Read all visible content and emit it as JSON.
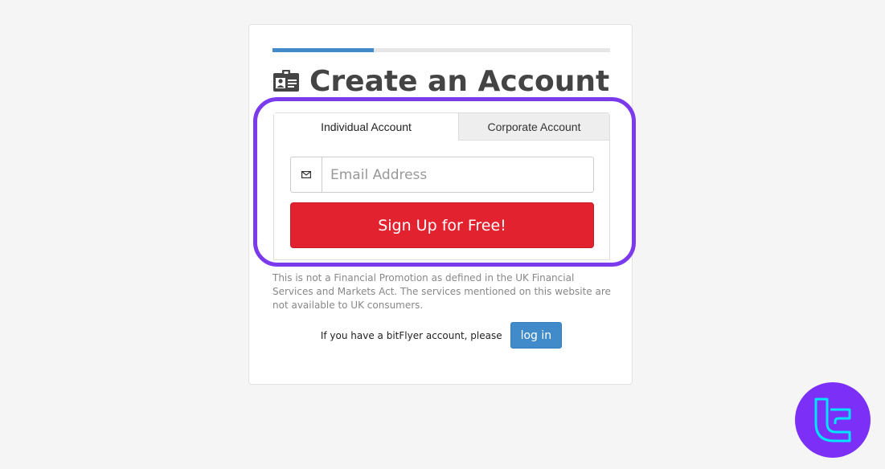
{
  "progress": {
    "fraction": 0.3
  },
  "header": {
    "title": "Create an Account",
    "icon": "id-card-icon"
  },
  "tabs": [
    {
      "label": "Individual Account",
      "active": true
    },
    {
      "label": "Corporate Account",
      "active": false
    }
  ],
  "form": {
    "email_placeholder": "Email Address",
    "email_value": "",
    "email_icon": "envelope-icon",
    "signup_label": "Sign Up for Free!"
  },
  "disclaimer": "This is not a Financial Promotion as defined in the UK Financial Services and Markets Act. The services mentioned on this website are not available to UK consumers.",
  "login": {
    "prompt": "If you have a bitFlyer account, please",
    "button_label": "log in"
  },
  "colors": {
    "accent_blue": "#428bca",
    "signup_red": "#e3222f",
    "highlight_purple": "#7c3aed",
    "logo_purple": "#7b2ff7",
    "logo_cyan": "#00e5ff"
  },
  "logo": {
    "icon": "tc-logo-icon"
  }
}
